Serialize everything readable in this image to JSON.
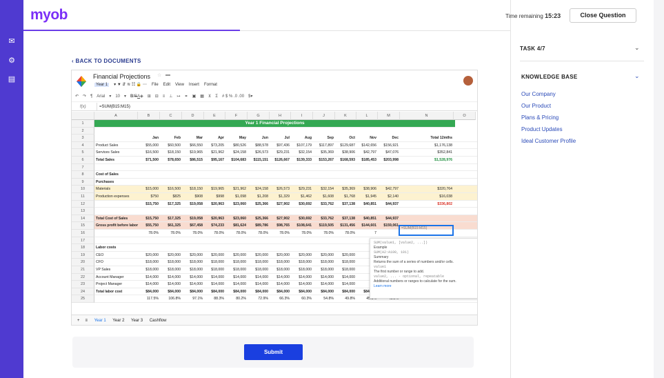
{
  "brand": {
    "logo": "myob"
  },
  "header": {
    "time_label": "Time remaining",
    "time_value": "15:23",
    "close_label": "Close Question"
  },
  "task": {
    "label": "TASK 4/7"
  },
  "kb": {
    "title": "KNOWLEDGE BASE",
    "links": [
      "Our Company",
      "Our Product",
      "Plans & Pricing",
      "Product Updates",
      "Ideal Customer Profile"
    ]
  },
  "nav": {
    "back": "BACK TO DOCUMENTS"
  },
  "sheet": {
    "title": "Financial Projections",
    "menu": [
      "Year 1",
      "File",
      "Edit",
      "View",
      "Insert",
      "Format"
    ],
    "font": "Arial",
    "font_size": "10",
    "formula": "=SUM(B15:M15)",
    "cols": [
      "",
      "A",
      "B",
      "C",
      "D",
      "E",
      "F",
      "G",
      "H",
      "I",
      "J",
      "K",
      "L",
      "M",
      "N",
      "O"
    ],
    "banner": "Year 1 Financial Projections",
    "header_row": [
      "",
      "Jan",
      "Feb",
      "Mar",
      "Apr",
      "May",
      "Jun",
      "Jul",
      "Aug",
      "Sep",
      "Oct",
      "Nov",
      "Dec",
      "Total 12mths"
    ],
    "rows": [
      {
        "n": "4",
        "cells": [
          "Product Sales",
          "$55,000",
          "$60,500",
          "$66,550",
          "$73,205",
          "$80,526",
          "$88,578",
          "$97,436",
          "$107,179",
          "$117,897",
          "$129,687",
          "$142,656",
          "$156,921",
          "$1,176,138"
        ]
      },
      {
        "n": "5",
        "cells": [
          "Services Sales",
          "$16,500",
          "$18,150",
          "$19,965",
          "$21,962",
          "$24,158",
          "$26,573",
          "$29,231",
          "$32,154",
          "$35,369",
          "$38,906",
          "$42,797",
          "$47,076",
          "$352,841"
        ]
      },
      {
        "n": "6",
        "cells": [
          "Total Sales",
          "$71,500",
          "$78,650",
          "$86,515",
          "$95,167",
          "$104,683",
          "$115,151",
          "$126,667",
          "$139,333",
          "$153,267",
          "$168,593",
          "$185,453",
          "$203,998",
          "$1,528,976"
        ]
      },
      {
        "n": "7",
        "cells": []
      },
      {
        "n": "8",
        "cells": [
          "Cost of Sales"
        ]
      },
      {
        "n": "9",
        "cells": [
          "Purchases"
        ]
      },
      {
        "n": "10",
        "cells": [
          "Materials",
          "$15,000",
          "$16,500",
          "$18,150",
          "$19,965",
          "$21,962",
          "$24,158",
          "$26,573",
          "$29,231",
          "$32,154",
          "$35,369",
          "$38,906",
          "$42,797",
          "$320,764"
        ]
      },
      {
        "n": "11",
        "cells": [
          "Production expenses",
          "$750",
          "$825",
          "$908",
          "$998",
          "$1,098",
          "$1,208",
          "$1,329",
          "$1,462",
          "$1,608",
          "$1,768",
          "$1,945",
          "$2,140",
          "$16,038"
        ]
      },
      {
        "n": "12",
        "cells": [
          "",
          "$15,750",
          "$17,325",
          "$19,058",
          "$20,963",
          "$23,060",
          "$25,366",
          "$27,902",
          "$30,692",
          "$33,762",
          "$37,138",
          "$40,851",
          "$44,937",
          "$336,802"
        ]
      },
      {
        "n": "13",
        "cells": []
      },
      {
        "n": "14",
        "cells": [
          "Total Cost of Sales",
          "$15,750",
          "$17,325",
          "$19,058",
          "$20,963",
          "$23,060",
          "$25,366",
          "$27,902",
          "$30,692",
          "$33,762",
          "$37,138",
          "$40,851",
          "$44,937",
          ""
        ]
      },
      {
        "n": "15",
        "cells": [
          "Gross profit before labor",
          "$55,750",
          "$61,325",
          "$67,458",
          "$74,233",
          "$81,624",
          "$89,786",
          "$98,765",
          "$108,641",
          "$119,505",
          "$131,456",
          "$144,601",
          "$159,061",
          ""
        ]
      },
      {
        "n": "16",
        "cells": [
          "",
          "78.0%",
          "78.0%",
          "78.0%",
          "78.0%",
          "78.0%",
          "78.0%",
          "78.0%",
          "78.0%",
          "78.0%",
          "78.0%",
          "7",
          ""
        ]
      },
      {
        "n": "17",
        "cells": []
      },
      {
        "n": "18",
        "cells": [
          "Labor costs"
        ]
      },
      {
        "n": "19",
        "cells": [
          "CEO",
          "$20,000",
          "$20,000",
          "$20,000",
          "$20,000",
          "$20,000",
          "$20,000",
          "$20,000",
          "$20,000",
          "$20,000",
          "$20,000",
          "$2"
        ]
      },
      {
        "n": "20",
        "cells": [
          "CFO",
          "$18,000",
          "$18,000",
          "$18,000",
          "$18,000",
          "$18,000",
          "$18,000",
          "$18,000",
          "$18,000",
          "$18,000",
          "$18,000",
          "$1"
        ]
      },
      {
        "n": "21",
        "cells": [
          "VP Sales",
          "$18,000",
          "$18,000",
          "$18,000",
          "$18,000",
          "$18,000",
          "$18,000",
          "$18,000",
          "$18,000",
          "$18,000",
          "$18,000",
          "$1"
        ]
      },
      {
        "n": "22",
        "cells": [
          "Account Manager",
          "$14,000",
          "$14,000",
          "$14,000",
          "$14,000",
          "$14,000",
          "$14,000",
          "$14,000",
          "$14,000",
          "$14,000",
          "$14,000",
          "$1"
        ]
      },
      {
        "n": "23",
        "cells": [
          "Project Manager",
          "$14,000",
          "$14,000",
          "$14,000",
          "$14,000",
          "$14,000",
          "$14,000",
          "$14,000",
          "$14,000",
          "$14,000",
          "$14,000",
          "$1"
        ]
      },
      {
        "n": "24",
        "cells": [
          "Total labor cost",
          "$84,000",
          "$84,000",
          "$84,000",
          "$84,000",
          "$84,000",
          "$84,000",
          "$84,000",
          "$84,000",
          "$84,000",
          "$84,000",
          "$84,000",
          "$84,000",
          "$1,008,000"
        ]
      },
      {
        "n": "25",
        "cells": [
          "",
          "117.5%",
          "106.8%",
          "97.1%",
          "88.3%",
          "80.2%",
          "72.9%",
          "66.3%",
          "60.3%",
          "54.8%",
          "49.8%",
          "45.3%",
          "41.2%",
          ""
        ]
      }
    ],
    "active_cell": "=SUM(B15:M15)",
    "popup": {
      "sig": "SUM(value1, [value2, ...])",
      "ex_label": "Example",
      "ex": "SUM(A2:A100, 101)",
      "sum_label": "Summary",
      "sum": "Returns the sum of a series of numbers and/or cells.",
      "v1": "value1",
      "v1d": "The first number or range to add.",
      "v2": "value2, ... - optional, repeatable",
      "v2d": "Additional numbers or ranges to calculate for the sum.",
      "learn": "Learn more"
    },
    "tabs": [
      "Year 1",
      "Year 2",
      "Year 3",
      "Cashflow"
    ]
  },
  "actions": {
    "submit": "Submit"
  }
}
